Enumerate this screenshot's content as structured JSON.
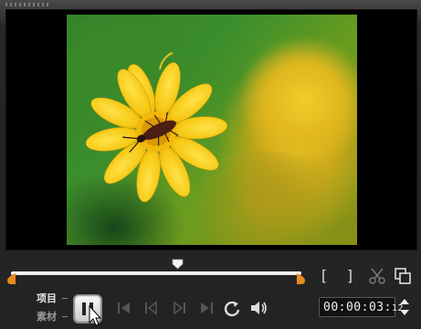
{
  "preview": {
    "content": "yellow flower with beetle"
  },
  "controls": {
    "mode_project": "项目",
    "mode_clip": "素材",
    "mark_in": "[",
    "mark_out": "]"
  },
  "timecode": {
    "main": "00:00:03:",
    "frames": "12"
  },
  "colors": {
    "trim_marker": "#e68a1f",
    "track": "#f2f2f2",
    "background": "#232323"
  },
  "icons": [
    "grip-icon",
    "playhead-icon",
    "trim-left-icon",
    "trim-right-icon",
    "cut-icon",
    "duplicate-icon",
    "pause-icon",
    "home-icon",
    "previous-frame-icon",
    "next-frame-icon",
    "end-icon",
    "repeat-icon",
    "volume-icon",
    "spinner-up-icon",
    "spinner-down-icon",
    "cursor-icon"
  ]
}
